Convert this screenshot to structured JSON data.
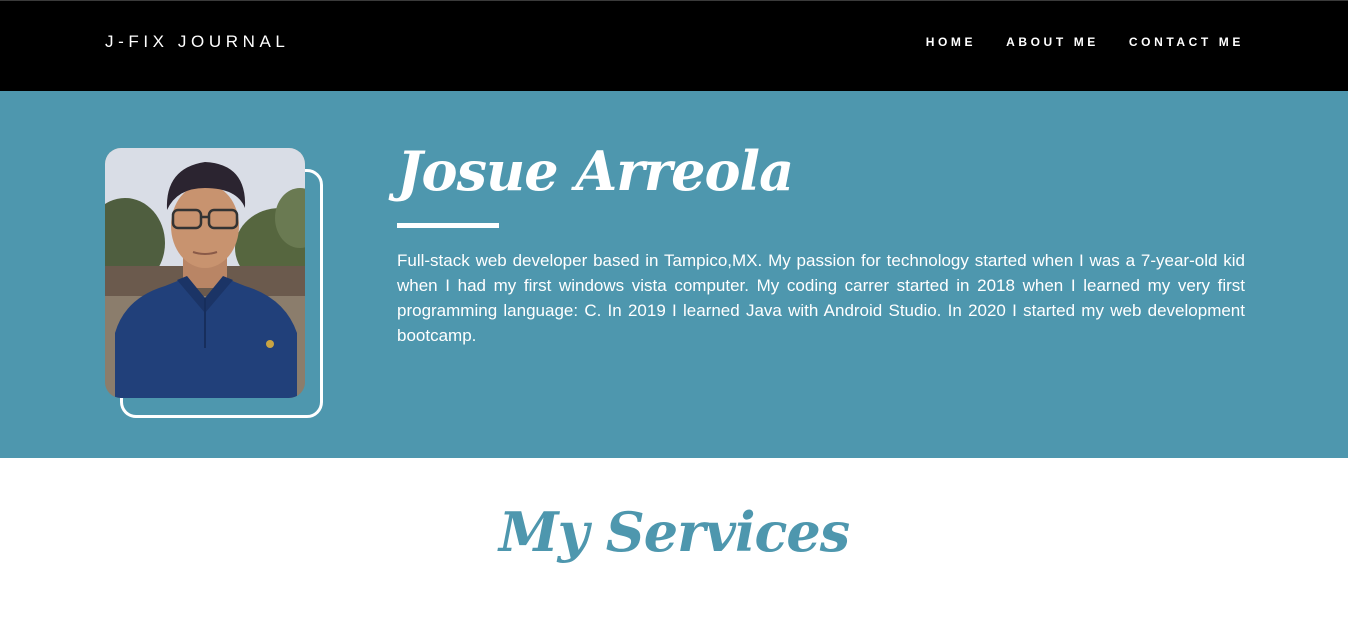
{
  "navbar": {
    "brand": "J-FIX JOURNAL",
    "links": [
      "HOME",
      "ABOUT ME",
      "CONTACT ME"
    ]
  },
  "hero": {
    "name": "Josue Arreola",
    "bio": "Full-stack web developer based in Tampico,MX. My passion for technology started when I was a 7-year-old kid when I had my first windows vista computer. My coding carrer started in 2018 when I learned my very first programming language: C. In 2019 I learned Java with Android Studio. In 2020 I started my web development bootcamp."
  },
  "services": {
    "title": "My Services"
  },
  "colors": {
    "navbar_bg": "#000000",
    "hero_bg": "#4e97ae",
    "accent": "#4e97ae",
    "text_light": "#ffffff"
  },
  "icons": {
    "profile_photo": "profile-photo"
  }
}
